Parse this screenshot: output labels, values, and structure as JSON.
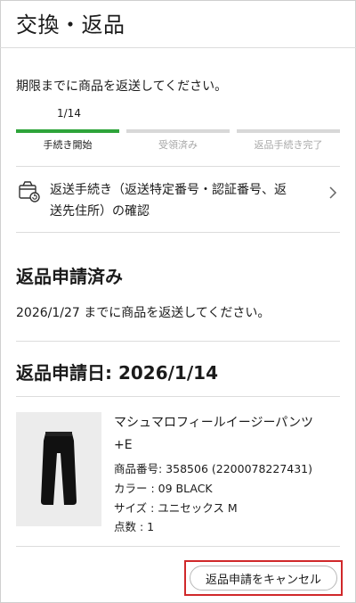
{
  "header": {
    "title": "交換・返品"
  },
  "instruction": "期限までに商品を返送してください。",
  "progress": {
    "count_label": "1/14",
    "steps": [
      {
        "label": "手続き開始",
        "state": "active"
      },
      {
        "label": "受領済み",
        "state": "inactive"
      },
      {
        "label": "返品手続き完了",
        "state": "inactive"
      }
    ],
    "colors": {
      "active": "#2ea43a",
      "inactive": "#d8d8d8"
    }
  },
  "procedure_link": {
    "icon": "return-box-icon",
    "line1": "返送手続き（返送特定番号・認証番号、返",
    "line2": "送先住所）の確認"
  },
  "status": {
    "title": "返品申請済み",
    "deadline_text": "2026/1/27 までに商品を返送してください。"
  },
  "request_date": "返品申請日: 2026/1/14",
  "product": {
    "name_line1": "マシュマロフィールイージーパンツ",
    "name_line2": "+E",
    "number": "商品番号: 358506 (2200078227431)",
    "color": "カラー : 09 BLACK",
    "size": "サイズ : ユニセックス M",
    "quantity": "点数 : 1"
  },
  "cancel_button": {
    "label": "返品申請をキャンセル",
    "highlight_color": "#d0282a"
  }
}
